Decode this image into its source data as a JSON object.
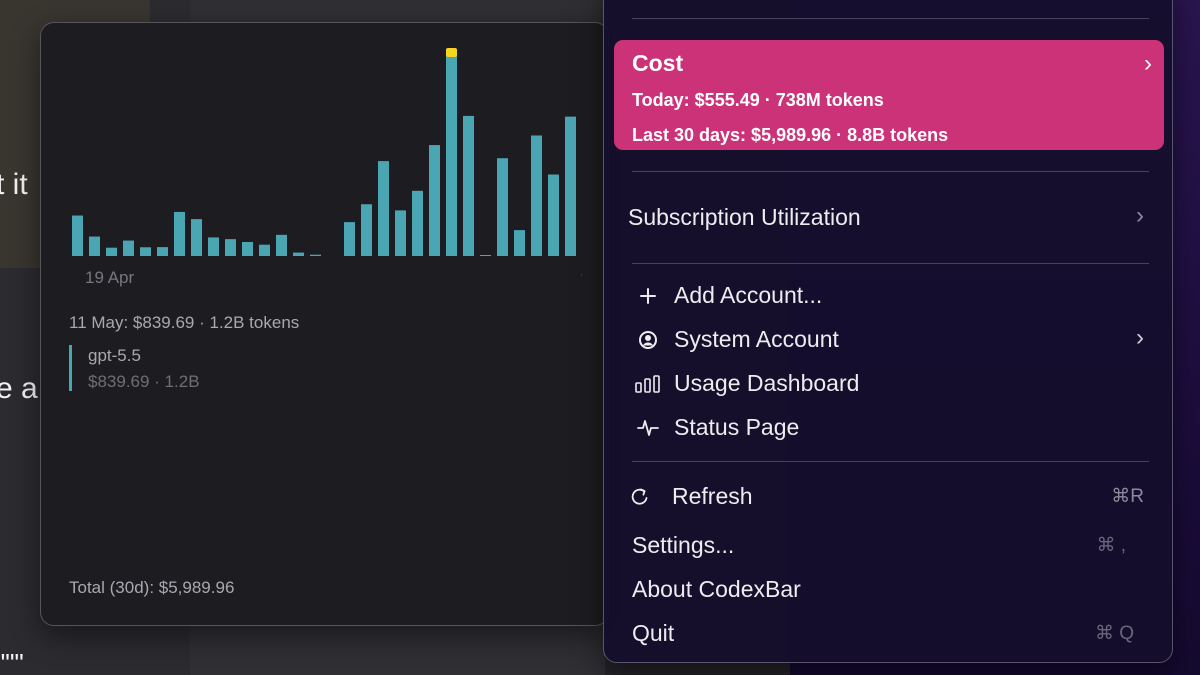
{
  "background": {
    "text_fragments": [
      "t it",
      "e a",
      "\"\"\""
    ]
  },
  "chart_popover": {
    "axis_start_label": "19 Apr",
    "selected_summary": "11 May: $839.69 · 1.2B tokens",
    "model": {
      "name": "gpt-5.5",
      "detail": "$839.69 · 1.2B"
    },
    "total_label": "Total (30d): $5,989.96",
    "colors": {
      "bar": "#4ba6b4",
      "highlight": "#f5d51e"
    }
  },
  "chart_data": {
    "type": "bar",
    "x_start": "19 Apr",
    "highlight_index": 22,
    "values_usd": [
      283,
      136,
      58,
      108,
      61,
      62,
      308,
      258,
      130,
      118,
      98,
      79,
      148,
      24,
      9,
      0,
      237,
      362,
      664,
      319,
      456,
      776,
      1448,
      980,
      7,
      684,
      181,
      843,
      570,
      975
    ]
  },
  "menu": {
    "cost": {
      "title": "Cost",
      "today": "Today: $555.49 · 738M tokens",
      "last30": "Last 30 days: $5,989.96 · 8.8B tokens"
    },
    "subscription_label": "Subscription Utilization",
    "items": {
      "add_account": "Add Account...",
      "system_account": "System Account",
      "usage_dashboard": "Usage Dashboard",
      "status_page": "Status Page",
      "refresh": "Refresh",
      "settings": "Settings...",
      "about": "About CodexBar",
      "quit": "Quit"
    },
    "shortcuts": {
      "refresh": "⌘R",
      "settings": "⌘ ,",
      "quit": "⌘ Q"
    },
    "colors": {
      "cost_card": "#cc3278"
    }
  }
}
